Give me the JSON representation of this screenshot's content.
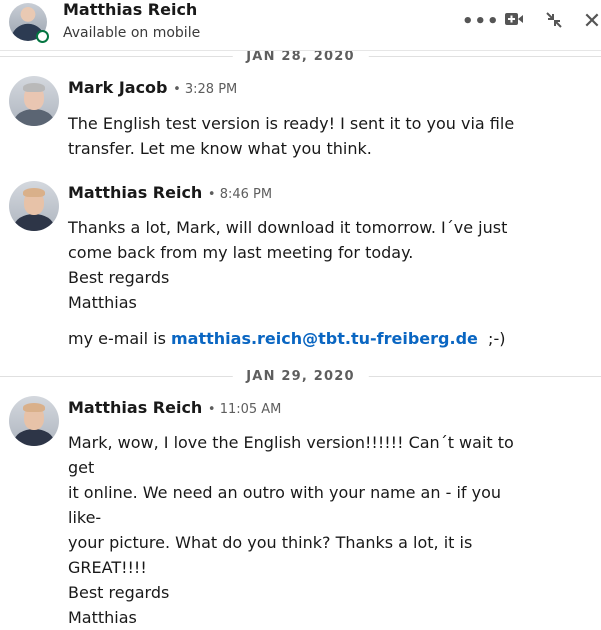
{
  "header": {
    "name": "Matthias Reich",
    "status": "Available on mobile",
    "icons": [
      "more-icon",
      "video-icon",
      "collapse-icon",
      "close-icon"
    ],
    "online_color": "#057642"
  },
  "dividers": [
    "JAN 28, 2020",
    "JAN 29, 2020"
  ],
  "messages": [
    {
      "sender": "Mark Jacob",
      "time": "• 3:28 PM",
      "lines": [
        "The English test version is ready! I sent it to you via file",
        "transfer. Let me know what you think."
      ]
    },
    {
      "sender": "Matthias Reich",
      "time": "• 8:46 PM",
      "lines": [
        "Thanks a lot, Mark, will download it tomorrow. I´ve just",
        "come back from my last meeting for today.",
        "Best regards",
        "Matthias"
      ],
      "email_prefix": "my e-mail is",
      "email": "matthias.reich@tbt.tu-freiberg.de",
      "email_suffix": ";-)"
    },
    {
      "sender": "Matthias Reich",
      "time": "• 11:05 AM",
      "lines": [
        "Mark, wow, I love the English version!!!!!! Can´t wait to get",
        "it online. We need an outro with your name an - if you like-",
        "your picture. What do you think? Thanks a lot, it is",
        "GREAT!!!!",
        "Best regards",
        "Matthias"
      ]
    }
  ],
  "colors": {
    "link": "#0a66c2",
    "text": "#191919",
    "muted": "#5e5e5e"
  }
}
